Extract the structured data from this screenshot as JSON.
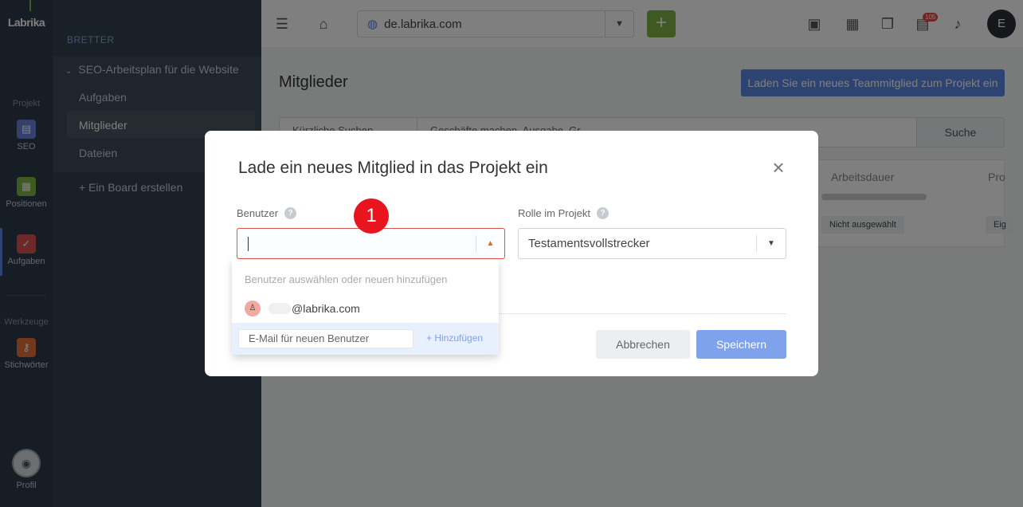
{
  "rail": {
    "logo": "Labrika",
    "section_project": "Projekt",
    "section_tools": "Werkzeuge",
    "items": [
      {
        "label": "SEO",
        "icon": "clipboard-icon",
        "color": "#6b7fd6"
      },
      {
        "label": "Positionen",
        "icon": "chart-icon",
        "color": "#7cb342"
      },
      {
        "label": "Aufgaben",
        "icon": "check-icon",
        "color": "#d9534f"
      },
      {
        "label": "Stichwörter",
        "icon": "key-icon",
        "color": "#e2703a"
      }
    ],
    "profile_label": "Profil"
  },
  "sidebar": {
    "header": "BRETTER",
    "board_name": "SEO-Arbeitsplan für die Website",
    "items": [
      "Aufgaben",
      "Mitglieder",
      "Dateien"
    ],
    "selected": "Mitglieder",
    "create_board": "+ Ein Board erstellen"
  },
  "topbar": {
    "domain": "de.labrika.com",
    "badge_count": "105",
    "user_initial": "E"
  },
  "page": {
    "title": "Mitglieder",
    "invite_button": "Laden Sie ein neues Teammitglied zum Projekt ein",
    "search_button": "Suche",
    "search_hint_left": "Kürzliche Suchen",
    "search_hint_right": "Geschäfte machen, Ausgabe, Gr",
    "columns": [
      "Arbeitsdauer",
      "Pro"
    ],
    "row_values": [
      "Nicht ausgewählt",
      "Eig"
    ]
  },
  "modal": {
    "title": "Lade ein neues Mitglied in das Projekt ein",
    "user_label": "Benutzer",
    "role_label": "Rolle im Projekt",
    "role_value": "Testamentsvollstrecker",
    "cancel": "Abbrechen",
    "save": "Speichern"
  },
  "dropdown": {
    "hint": "Benutzer auswählen oder neuen hinzufügen",
    "option_email": "@labrika.com",
    "email_placeholder": "E-Mail für neuen Benutzer",
    "add_button": "+ Hinzufügen"
  },
  "marker": "1"
}
